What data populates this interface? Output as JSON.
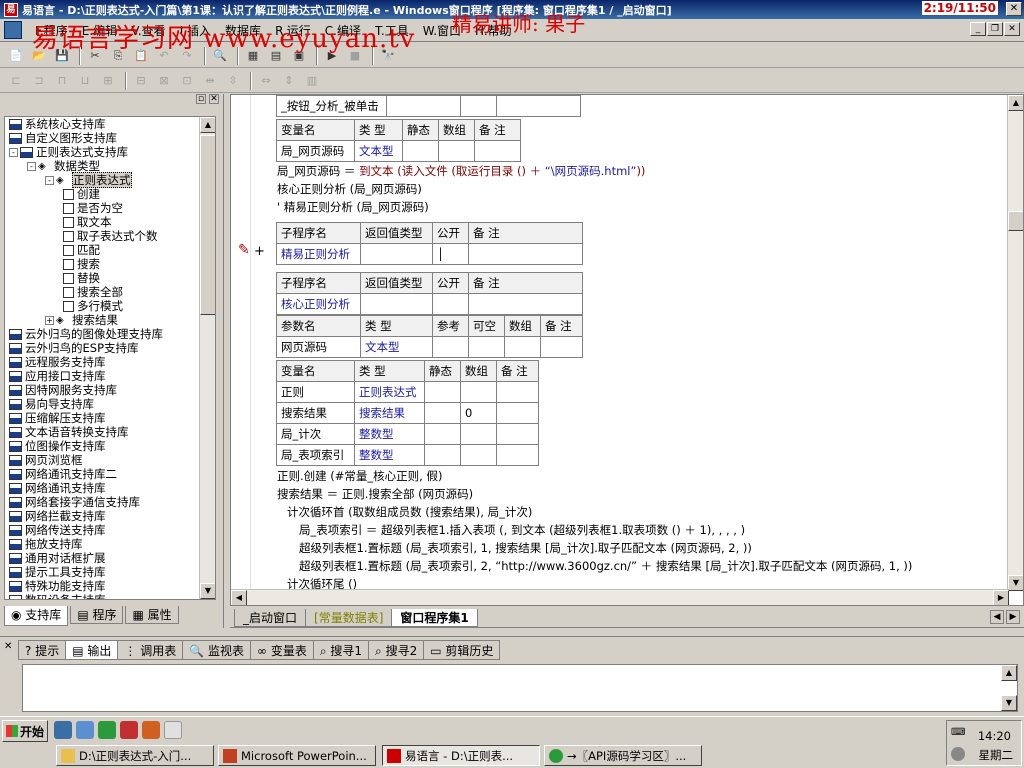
{
  "window": {
    "title": "易语言 - D:\\正则表达式-入门篇\\第1课：认识了解正则表达式\\正则例程.e - Windows窗口程序 [程序集: 窗口程序集1 / _启动窗口]",
    "clock": "2:19/11:50"
  },
  "watermark": {
    "site": "易语言学习网 www.eyuyan.tv",
    "teacher": "精易讲师: 果子"
  },
  "menu": [
    "F.程序",
    "E.编辑",
    "V.查看",
    "I.插入",
    "数据库",
    "R.运行",
    "C.编译",
    "T.工具",
    "W.窗口",
    "H.帮助"
  ],
  "tree": [
    {
      "label": "系统核心支持库",
      "level": 0,
      "icon": "lib"
    },
    {
      "label": "自定义图形支持库",
      "level": 0,
      "icon": "lib"
    },
    {
      "label": "正则表达式支持库",
      "level": 0,
      "icon": "lib",
      "exp": "-"
    },
    {
      "label": "数据类型",
      "level": 1,
      "icon": "gem",
      "exp": "-"
    },
    {
      "label": "正则表达式",
      "level": 2,
      "icon": "gem",
      "exp": "-",
      "selected": true
    },
    {
      "label": "创建",
      "level": 3,
      "icon": "doc"
    },
    {
      "label": "是否为空",
      "level": 3,
      "icon": "doc"
    },
    {
      "label": "取文本",
      "level": 3,
      "icon": "doc"
    },
    {
      "label": "取子表达式个数",
      "level": 3,
      "icon": "doc"
    },
    {
      "label": "匹配",
      "level": 3,
      "icon": "doc"
    },
    {
      "label": "搜索",
      "level": 3,
      "icon": "doc"
    },
    {
      "label": "替换",
      "level": 3,
      "icon": "doc"
    },
    {
      "label": "搜索全部",
      "level": 3,
      "icon": "doc"
    },
    {
      "label": "多行模式",
      "level": 3,
      "icon": "doc"
    },
    {
      "label": "搜索结果",
      "level": 2,
      "icon": "gem",
      "exp": "+"
    },
    {
      "label": "云外归鸟的图像处理支持库",
      "level": 0,
      "icon": "lib"
    },
    {
      "label": "云外归鸟的ESP支持库",
      "level": 0,
      "icon": "lib"
    },
    {
      "label": "远程服务支持库",
      "level": 0,
      "icon": "lib"
    },
    {
      "label": "应用接口支持库",
      "level": 0,
      "icon": "lib"
    },
    {
      "label": "因特网服务支持库",
      "level": 0,
      "icon": "lib"
    },
    {
      "label": "易向导支持库",
      "level": 0,
      "icon": "lib"
    },
    {
      "label": "压缩解压支持库",
      "level": 0,
      "icon": "lib"
    },
    {
      "label": "文本语音转换支持库",
      "level": 0,
      "icon": "lib"
    },
    {
      "label": "位图操作支持库",
      "level": 0,
      "icon": "lib"
    },
    {
      "label": "网页浏览框",
      "level": 0,
      "icon": "lib"
    },
    {
      "label": "网络通讯支持库二",
      "level": 0,
      "icon": "lib"
    },
    {
      "label": "网络通讯支持库",
      "level": 0,
      "icon": "lib"
    },
    {
      "label": "网络套接字通信支持库",
      "level": 0,
      "icon": "lib"
    },
    {
      "label": "网络拦截支持库",
      "level": 0,
      "icon": "lib"
    },
    {
      "label": "网络传送支持库",
      "level": 0,
      "icon": "lib"
    },
    {
      "label": "拖放支持库",
      "level": 0,
      "icon": "lib"
    },
    {
      "label": "通用对话框扩展",
      "level": 0,
      "icon": "lib"
    },
    {
      "label": "提示工具支持库",
      "level": 0,
      "icon": "lib"
    },
    {
      "label": "特殊功能支持库",
      "level": 0,
      "icon": "lib"
    },
    {
      "label": "数码设备支持库",
      "level": 0,
      "icon": "lib"
    }
  ],
  "left_tabs": [
    "支持库",
    "程序",
    "属性"
  ],
  "editor": {
    "top_row": "_按钮_分析_被单击",
    "var1_headers": [
      "变量名",
      "类 型",
      "静态",
      "数组",
      "备 注"
    ],
    "var1_row": [
      "局_网页源码",
      "文本型"
    ],
    "code1": [
      {
        "a": "局_网页源码 ＝ ",
        "b": "到文本 (读入文件 (取运行目录 () ＋ ",
        "c": "“\\网页源码.html”",
        "d": "))"
      },
      {
        "a": "",
        "b": "核心正则分析 (局_网页源码)",
        "c": "",
        "d": ""
      },
      {
        "a": "",
        "b": "' 精易正则分析 (局_网页源码)",
        "c": "",
        "d": ""
      }
    ],
    "sub_headers": [
      "子程序名",
      "返回值类型",
      "公开",
      "备 注"
    ],
    "sub1_name": "精易正则分析",
    "sub2_name": "核心正则分析",
    "param_headers": [
      "参数名",
      "类 型",
      "参考",
      "可空",
      "数组",
      "备 注"
    ],
    "param_row": [
      "网页源码",
      "文本型"
    ],
    "var2_headers": [
      "变量名",
      "类 型",
      "静态",
      "数组",
      "备 注"
    ],
    "var2_rows": [
      [
        "正则",
        "正则表达式",
        "",
        ""
      ],
      [
        "搜索结果",
        "搜索结果",
        "",
        "0"
      ],
      [
        "局_计次",
        "整数型",
        "",
        ""
      ],
      [
        "局_表项索引",
        "整数型",
        "",
        ""
      ]
    ],
    "code2": [
      "正则.创建 (#常量_核心正则, 假)",
      "搜索结果 ＝ 正则.搜索全部 (网页源码)",
      "计次循环首 (取数组成员数 (搜索结果), 局_计次)",
      "局_表项索引 ＝ 超级列表框1.插入表项 (, 到文本 (超级列表框1.取表项数 () ＋ 1), , , , )",
      "超级列表框1.置标题 (局_表项索引, 1, 搜索结果 [局_计次].取子匹配文本 (网页源码, 2, ))",
      "超级列表框1.置标题 (局_表项索引, 2, “http://www.3600gz.cn/” ＋ 搜索结果 [局_计次].取子匹配文本 (网页源码, 1, ))",
      "计次循环尾 ()"
    ]
  },
  "editor_tabs": [
    "_启动窗口",
    "[常量数据表]",
    "窗口程序集1"
  ],
  "bottom_tabs": [
    "提示",
    "输出",
    "调用表",
    "监视表",
    "变量表",
    "搜寻1",
    "搜寻2",
    "剪辑历史"
  ],
  "taskbar": {
    "start": "开始",
    "tasks": [
      "D:\\正则表达式-入门...",
      "Microsoft PowerPoin...",
      "易语言 - D:\\正则表...",
      "→〖API源码学习区〗..."
    ],
    "time": "14:20",
    "day": "星期二"
  }
}
